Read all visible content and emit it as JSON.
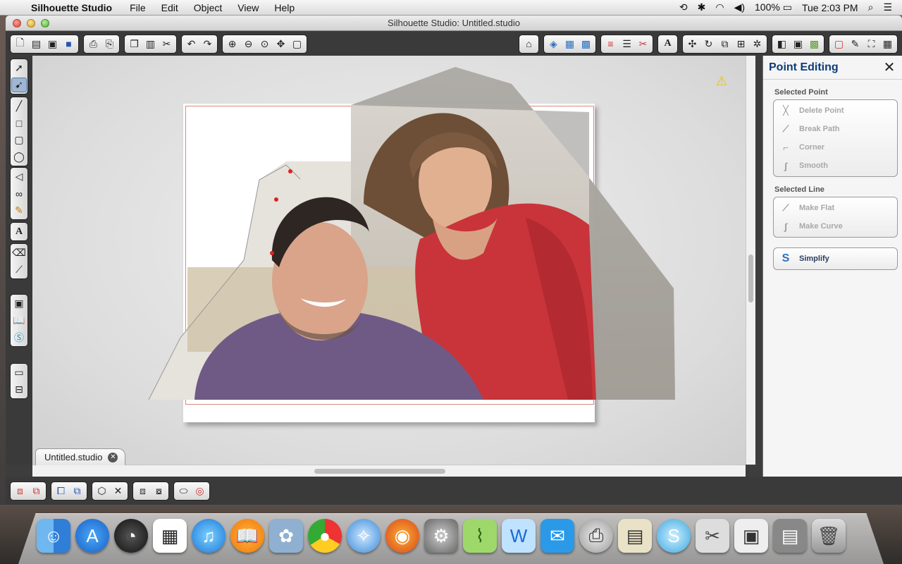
{
  "menubar": {
    "app_name": "Silhouette Studio",
    "items": [
      "File",
      "Edit",
      "Object",
      "View",
      "Help"
    ],
    "battery": "100%",
    "clock": "Tue 2:03 PM"
  },
  "window": {
    "title": "Silhouette Studio: Untitled.studio",
    "doc_tab": "Untitled.studio",
    "tab_close_glyph": "✕"
  },
  "panel": {
    "title": "Point Editing",
    "close_glyph": "✕",
    "selected_point_label": "Selected Point",
    "point_actions": [
      "Delete Point",
      "Break Path",
      "Corner",
      "Smooth"
    ],
    "selected_line_label": "Selected Line",
    "line_actions": [
      "Make Flat",
      "Make Curve"
    ],
    "simplify": "Simplify"
  },
  "colors": {
    "panel_title": "#0c3c78",
    "cut_line": "#d98a80",
    "shirt_purple": "#6f5a86",
    "sweater_red": "#c8343a"
  },
  "icons": {
    "toolbar_left": [
      "new-doc-icon",
      "open-icon",
      "save-icon",
      "save-library-icon",
      "print-icon",
      "print-cut-icon",
      "copy-icon",
      "paste-icon",
      "cut-icon",
      "undo-icon",
      "redo-icon",
      "zoom-in-icon",
      "zoom-out-icon",
      "zoom-select-icon",
      "pan-icon",
      "fit-page-icon"
    ],
    "toolbar_right": [
      "store-icon",
      "fill-icon",
      "fill-pattern-icon",
      "gradient-icon",
      "line-color-icon",
      "line-style-icon",
      "cut-settings-icon",
      "text-icon",
      "transform-icon",
      "rotate-icon",
      "scale-icon",
      "align-icon",
      "replicate-icon",
      "trace-icon",
      "offset-icon",
      "modify-icon",
      "page-setup-icon",
      "pen-icon",
      "crop-icon",
      "grid-icon"
    ]
  }
}
